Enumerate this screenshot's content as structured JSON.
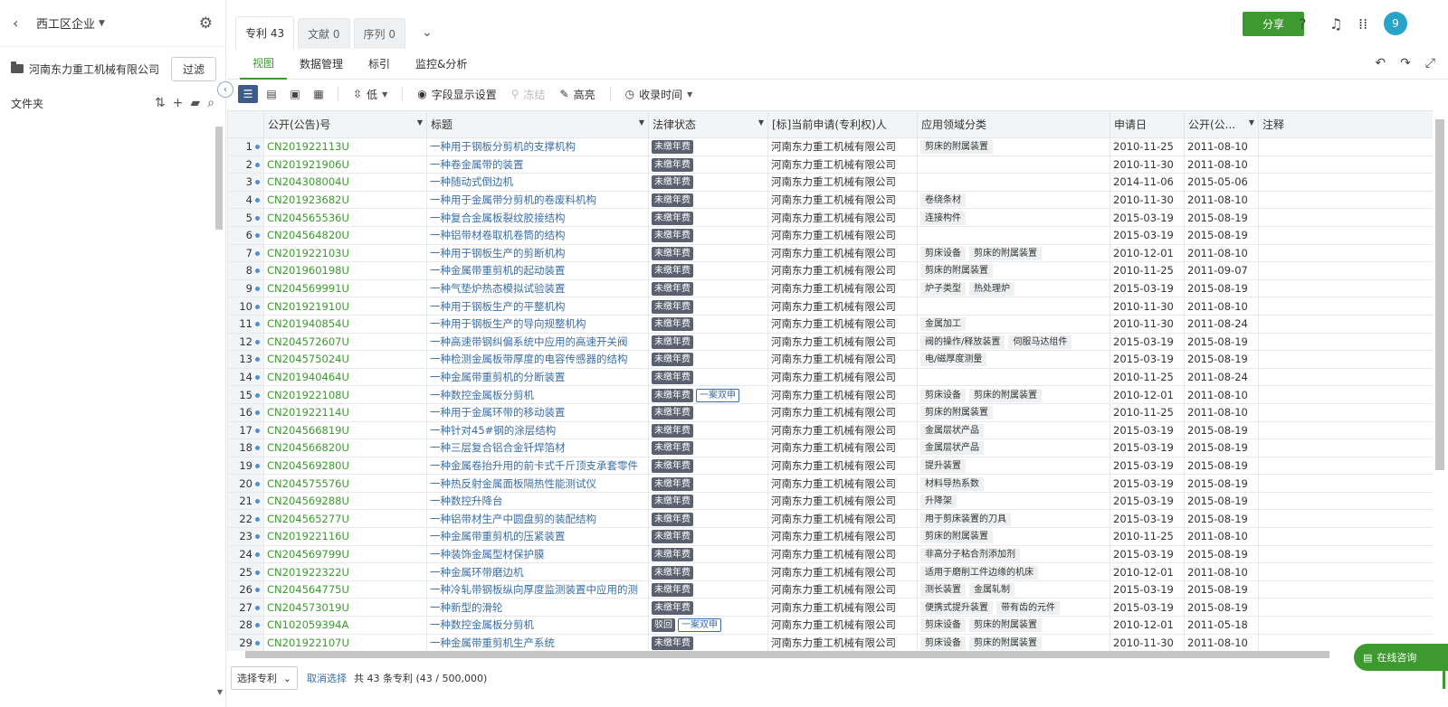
{
  "sidebar": {
    "title": "西工区企业",
    "company": "河南东力重工机械有限公司",
    "filter_label": "过滤",
    "folders_label": "文件夹"
  },
  "tabs": [
    {
      "label": "专利 43",
      "active": true
    },
    {
      "label": "文献 0",
      "active": false
    },
    {
      "label": "序列 0",
      "active": false
    }
  ],
  "header": {
    "share_label": "分享",
    "avatar_label": "9"
  },
  "subnav": [
    {
      "label": "视图",
      "active": true
    },
    {
      "label": "数据管理",
      "active": false
    },
    {
      "label": "标引",
      "active": false
    },
    {
      "label": "监控&分析",
      "active": false
    }
  ],
  "toolbar": {
    "density_label": "低",
    "fields_label": "字段显示设置",
    "freeze_label": "冻结",
    "highlight_label": "高亮",
    "sort_label": "收录时间"
  },
  "table": {
    "columns": [
      "公开(公告)号",
      "标题",
      "法律状态",
      "[标]当前申请(专利权)人",
      "应用领域分类",
      "申请日",
      "公开(公...",
      "注释"
    ],
    "rows": [
      {
        "no": "1",
        "pn": "CN201922113U",
        "title": "一种用于钢板分剪机的支撑机构",
        "legal": "未缴年费",
        "twin": "",
        "applicant": "河南东力重工机械有限公司",
        "tags": [
          "剪床的附属装置"
        ],
        "app_date": "2010-11-25",
        "pub_date": "2011-08-10"
      },
      {
        "no": "2",
        "pn": "CN201921906U",
        "title": "一种卷金属带的装置",
        "legal": "未缴年费",
        "twin": "",
        "applicant": "河南东力重工机械有限公司",
        "tags": [],
        "app_date": "2010-11-30",
        "pub_date": "2011-08-10"
      },
      {
        "no": "3",
        "pn": "CN204308004U",
        "title": "一种随动式倒边机",
        "legal": "未缴年费",
        "twin": "",
        "applicant": "河南东力重工机械有限公司",
        "tags": [],
        "app_date": "2014-11-06",
        "pub_date": "2015-05-06"
      },
      {
        "no": "4",
        "pn": "CN201923682U",
        "title": "一种用于金属带分剪机的卷废料机构",
        "legal": "未缴年费",
        "twin": "",
        "applicant": "河南东力重工机械有限公司",
        "tags": [
          "卷绕条材"
        ],
        "app_date": "2010-11-30",
        "pub_date": "2011-08-10"
      },
      {
        "no": "5",
        "pn": "CN204565536U",
        "title": "一种复合金属板裂纹胶接结构",
        "legal": "未缴年费",
        "twin": "",
        "applicant": "河南东力重工机械有限公司",
        "tags": [
          "连接构件"
        ],
        "app_date": "2015-03-19",
        "pub_date": "2015-08-19"
      },
      {
        "no": "6",
        "pn": "CN204564820U",
        "title": "一种铝带材卷取机卷筒的结构",
        "legal": "未缴年费",
        "twin": "",
        "applicant": "河南东力重工机械有限公司",
        "tags": [],
        "app_date": "2015-03-19",
        "pub_date": "2015-08-19"
      },
      {
        "no": "7",
        "pn": "CN201922103U",
        "title": "一种用于钢板生产的剪断机构",
        "legal": "未缴年费",
        "twin": "",
        "applicant": "河南东力重工机械有限公司",
        "tags": [
          "剪床设备",
          "剪床的附属装置"
        ],
        "app_date": "2010-12-01",
        "pub_date": "2011-08-10"
      },
      {
        "no": "8",
        "pn": "CN201960198U",
        "title": "一种金属带重剪机的起动装置",
        "legal": "未缴年费",
        "twin": "",
        "applicant": "河南东力重工机械有限公司",
        "tags": [
          "剪床的附属装置"
        ],
        "app_date": "2010-11-25",
        "pub_date": "2011-09-07"
      },
      {
        "no": "9",
        "pn": "CN204569991U",
        "title": "一种气垫炉热态模拟试验装置",
        "legal": "未缴年费",
        "twin": "",
        "applicant": "河南东力重工机械有限公司",
        "tags": [
          "炉子类型",
          "热处理炉"
        ],
        "app_date": "2015-03-19",
        "pub_date": "2015-08-19"
      },
      {
        "no": "10",
        "pn": "CN201921910U",
        "title": "一种用于钢板生产的平整机构",
        "legal": "未缴年费",
        "twin": "",
        "applicant": "河南东力重工机械有限公司",
        "tags": [],
        "app_date": "2010-11-30",
        "pub_date": "2011-08-10"
      },
      {
        "no": "11",
        "pn": "CN201940854U",
        "title": "一种用于钢板生产的导向规整机构",
        "legal": "未缴年费",
        "twin": "",
        "applicant": "河南东力重工机械有限公司",
        "tags": [
          "金属加工"
        ],
        "app_date": "2010-11-30",
        "pub_date": "2011-08-24"
      },
      {
        "no": "12",
        "pn": "CN204572607U",
        "title": "一种高速带钢纠偏系统中应用的高速开关阀",
        "legal": "未缴年费",
        "twin": "",
        "applicant": "河南东力重工机械有限公司",
        "tags": [
          "阀的操作/释放装置",
          "伺服马达组件"
        ],
        "app_date": "2015-03-19",
        "pub_date": "2015-08-19"
      },
      {
        "no": "13",
        "pn": "CN204575024U",
        "title": "一种检测金属板带厚度的电容传感器的结构",
        "legal": "未缴年费",
        "twin": "",
        "applicant": "河南东力重工机械有限公司",
        "tags": [
          "电/磁厚度测量"
        ],
        "app_date": "2015-03-19",
        "pub_date": "2015-08-19"
      },
      {
        "no": "14",
        "pn": "CN201940464U",
        "title": "一种金属带重剪机的分断装置",
        "legal": "未缴年费",
        "twin": "",
        "applicant": "河南东力重工机械有限公司",
        "tags": [],
        "app_date": "2010-11-25",
        "pub_date": "2011-08-24"
      },
      {
        "no": "15",
        "pn": "CN201922108U",
        "title": "一种数控金属板分剪机",
        "legal": "未缴年费",
        "twin": "一案双申",
        "applicant": "河南东力重工机械有限公司",
        "tags": [
          "剪床设备",
          "剪床的附属装置"
        ],
        "app_date": "2010-12-01",
        "pub_date": "2011-08-10"
      },
      {
        "no": "16",
        "pn": "CN201922114U",
        "title": "一种用于金属环带的移动装置",
        "legal": "未缴年费",
        "twin": "",
        "applicant": "河南东力重工机械有限公司",
        "tags": [
          "剪床的附属装置"
        ],
        "app_date": "2010-11-25",
        "pub_date": "2011-08-10"
      },
      {
        "no": "17",
        "pn": "CN204566819U",
        "title": "一种针对45#钢的涂层结构",
        "legal": "未缴年费",
        "twin": "",
        "applicant": "河南东力重工机械有限公司",
        "tags": [
          "金属层状产品"
        ],
        "app_date": "2015-03-19",
        "pub_date": "2015-08-19"
      },
      {
        "no": "18",
        "pn": "CN204566820U",
        "title": "一种三层复合铝合金钎焊箔材",
        "legal": "未缴年费",
        "twin": "",
        "applicant": "河南东力重工机械有限公司",
        "tags": [
          "金属层状产品"
        ],
        "app_date": "2015-03-19",
        "pub_date": "2015-08-19"
      },
      {
        "no": "19",
        "pn": "CN204569280U",
        "title": "一种金属卷抬升用的前卡式千斤顶支承套零件",
        "legal": "未缴年费",
        "twin": "",
        "applicant": "河南东力重工机械有限公司",
        "tags": [
          "提升装置"
        ],
        "app_date": "2015-03-19",
        "pub_date": "2015-08-19"
      },
      {
        "no": "20",
        "pn": "CN204575576U",
        "title": "一种热反射金属面板隔热性能测试仪",
        "legal": "未缴年费",
        "twin": "",
        "applicant": "河南东力重工机械有限公司",
        "tags": [
          "材料导热系数"
        ],
        "app_date": "2015-03-19",
        "pub_date": "2015-08-19"
      },
      {
        "no": "21",
        "pn": "CN204569288U",
        "title": "一种数控升降台",
        "legal": "未缴年费",
        "twin": "",
        "applicant": "河南东力重工机械有限公司",
        "tags": [
          "升降架"
        ],
        "app_date": "2015-03-19",
        "pub_date": "2015-08-19"
      },
      {
        "no": "22",
        "pn": "CN204565277U",
        "title": "一种铝带材生产中圆盘剪的装配结构",
        "legal": "未缴年费",
        "twin": "",
        "applicant": "河南东力重工机械有限公司",
        "tags": [
          "用于剪床装置的刀具"
        ],
        "app_date": "2015-03-19",
        "pub_date": "2015-08-19"
      },
      {
        "no": "23",
        "pn": "CN201922116U",
        "title": "一种金属带重剪机的压紧装置",
        "legal": "未缴年费",
        "twin": "",
        "applicant": "河南东力重工机械有限公司",
        "tags": [
          "剪床的附属装置"
        ],
        "app_date": "2010-11-25",
        "pub_date": "2011-08-10"
      },
      {
        "no": "24",
        "pn": "CN204569799U",
        "title": "一种装饰金属型材保护膜",
        "legal": "未缴年费",
        "twin": "",
        "applicant": "河南东力重工机械有限公司",
        "tags": [
          "非高分子粘合剂添加剂"
        ],
        "app_date": "2015-03-19",
        "pub_date": "2015-08-19"
      },
      {
        "no": "25",
        "pn": "CN201922322U",
        "title": "一种金属环带磨边机",
        "legal": "未缴年费",
        "twin": "",
        "applicant": "河南东力重工机械有限公司",
        "tags": [
          "适用于磨削工件边缘的机床"
        ],
        "app_date": "2010-12-01",
        "pub_date": "2011-08-10"
      },
      {
        "no": "26",
        "pn": "CN204564775U",
        "title": "一种冷轧带钢板纵向厚度监测装置中应用的测",
        "legal": "未缴年费",
        "twin": "",
        "applicant": "河南东力重工机械有限公司",
        "tags": [
          "测长装置",
          "金属轧制"
        ],
        "app_date": "2015-03-19",
        "pub_date": "2015-08-19"
      },
      {
        "no": "27",
        "pn": "CN204573019U",
        "title": "一种新型的滑轮",
        "legal": "未缴年费",
        "twin": "",
        "applicant": "河南东力重工机械有限公司",
        "tags": [
          "便携式提升装置",
          "带有齿的元件"
        ],
        "app_date": "2015-03-19",
        "pub_date": "2015-08-19"
      },
      {
        "no": "28",
        "pn": "CN102059394A",
        "title": "一种数控金属板分剪机",
        "legal": "驳回",
        "twin": "一案双申",
        "applicant": "河南东力重工机械有限公司",
        "tags": [
          "剪床设备",
          "剪床的附属装置"
        ],
        "app_date": "2010-12-01",
        "pub_date": "2011-05-18"
      },
      {
        "no": "29",
        "pn": "CN201922107U",
        "title": "一种金属带重剪机生产系统",
        "legal": "未缴年费",
        "twin": "",
        "applicant": "河南东力重工机械有限公司",
        "tags": [
          "剪床设备",
          "剪床的附属装置"
        ],
        "app_date": "2010-11-30",
        "pub_date": "2011-08-10"
      }
    ]
  },
  "footer": {
    "select_label": "选择专利",
    "cancel_label": "取消选择",
    "total_text": "共 43 条专利 (43 / 500,000)"
  },
  "chat": {
    "label": "在线咨询"
  },
  "colors": {
    "brand_green": "#3c9a2f",
    "link_blue": "#3a6ea8",
    "legal_tag": "#5b6170",
    "avatar": "#27a5c8"
  }
}
